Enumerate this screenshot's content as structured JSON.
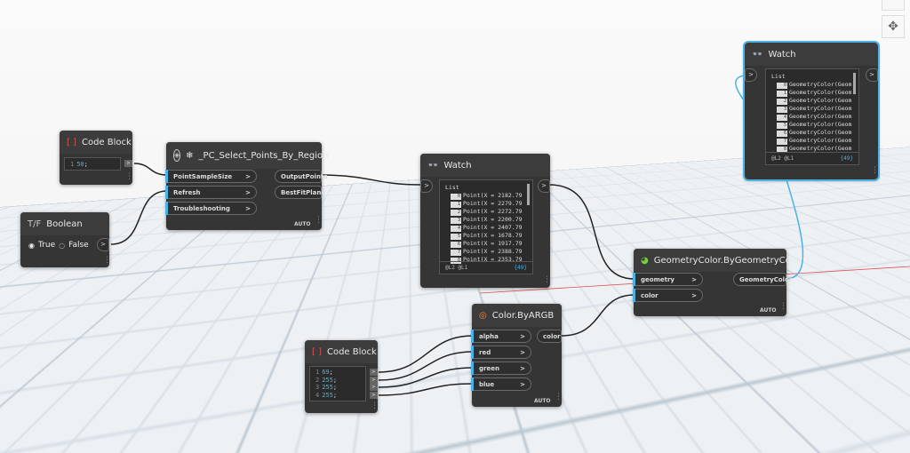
{
  "code_block_1": {
    "title": "Code Block",
    "lines": [
      {
        "n": "1",
        "v": "50",
        "s": ";"
      }
    ],
    "out": ">"
  },
  "boolean": {
    "title": "Boolean",
    "icon": "T/F",
    "true_label": "True",
    "false_label": "False",
    "selected": "True",
    "out": ">"
  },
  "pc_node": {
    "title": "_PC_Select_Points_By_Region",
    "inputs": [
      "PointSampleSize",
      "Refresh",
      "Troubleshooting"
    ],
    "outputs": [
      "OutputPoints",
      "BestFitPlane"
    ],
    "lacing": "AUTO"
  },
  "watch_1": {
    "title": "Watch",
    "list_label": "List",
    "items": [
      {
        "i": "0",
        "v": "Point(X = 2182.79"
      },
      {
        "i": "1",
        "v": "Point(X = 2279.79"
      },
      {
        "i": "2",
        "v": "Point(X = 2272.79"
      },
      {
        "i": "3",
        "v": "Point(X = 2200.79"
      },
      {
        "i": "4",
        "v": "Point(X = 2407.79"
      },
      {
        "i": "5",
        "v": "Point(X = 1678.79"
      },
      {
        "i": "6",
        "v": "Point(X = 1917.79"
      },
      {
        "i": "7",
        "v": "Point(X = 2388.79"
      },
      {
        "i": "8",
        "v": "Point(X = 2353.79"
      }
    ],
    "levels": "@L2 @L1",
    "count": "{49}"
  },
  "watch_2": {
    "title": "Watch",
    "list_label": "List",
    "items": [
      {
        "i": "0",
        "v": "GeometryColor(Geom"
      },
      {
        "i": "1",
        "v": "GeometryColor(Geom"
      },
      {
        "i": "2",
        "v": "GeometryColor(Geom"
      },
      {
        "i": "3",
        "v": "GeometryColor(Geom"
      },
      {
        "i": "4",
        "v": "GeometryColor(Geom"
      },
      {
        "i": "5",
        "v": "GeometryColor(Geom"
      },
      {
        "i": "6",
        "v": "GeometryColor(Geom"
      },
      {
        "i": "7",
        "v": "GeometryColor(Geom"
      },
      {
        "i": "8",
        "v": "GeometryColor(Geom"
      }
    ],
    "levels": "@L2 @L1",
    "count": "{49}"
  },
  "geometry_color": {
    "title": "GeometryColor.ByGeometryColor",
    "inputs": [
      "geometry",
      "color"
    ],
    "output": "GeometryColor",
    "lacing": "AUTO"
  },
  "color_argb": {
    "title": "Color.ByARGB",
    "inputs": [
      "alpha",
      "red",
      "green",
      "blue"
    ],
    "output": "color",
    "lacing": "AUTO"
  },
  "code_block_2": {
    "title": "Code Block",
    "lines": [
      {
        "n": "1",
        "v": "69",
        "s": ";"
      },
      {
        "n": "2",
        "v": "255",
        "s": ";"
      },
      {
        "n": "3",
        "v": "255",
        "s": ";"
      },
      {
        "n": "4",
        "v": "255",
        "s": ";"
      }
    ]
  },
  "port_arrow": ">",
  "colors": {
    "accent": "#4ab2e4",
    "node": "#353535",
    "wire": "#222222"
  },
  "controls": {
    "zoom_out": "−",
    "pan": "✥"
  }
}
